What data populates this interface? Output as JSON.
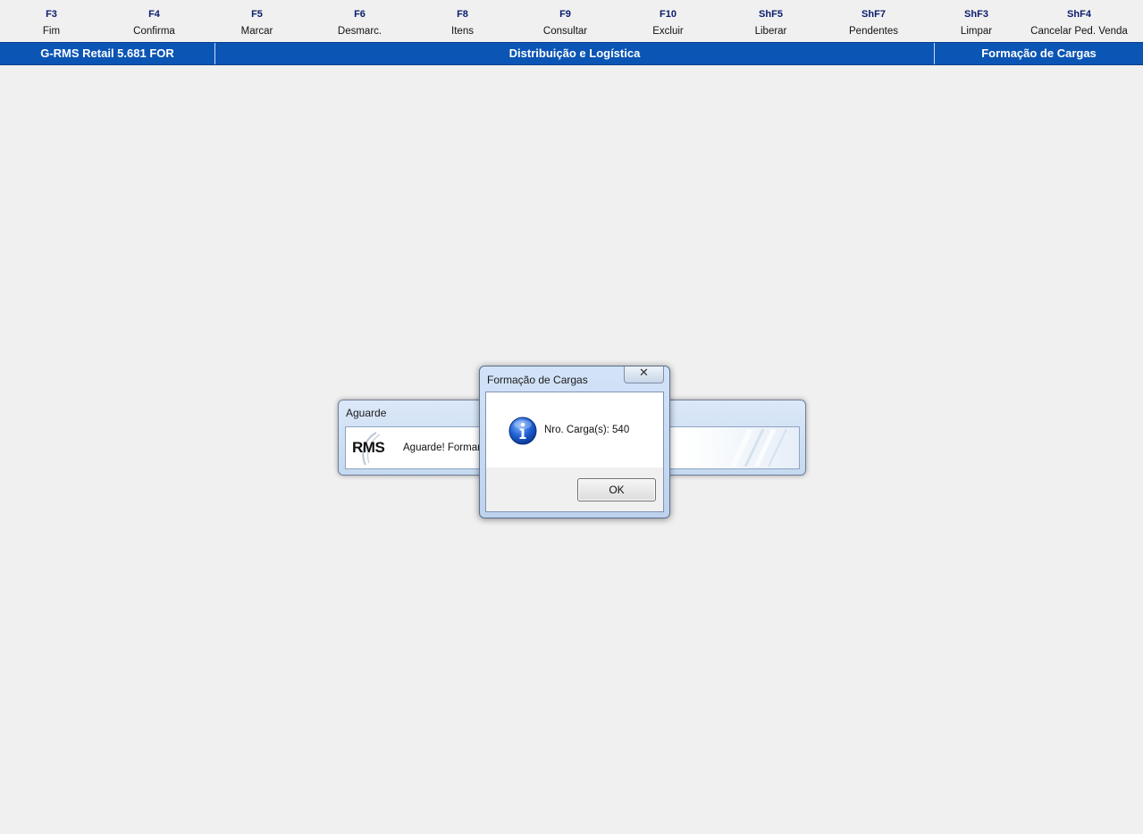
{
  "function_keys": [
    {
      "code": "F3",
      "label": "Fim"
    },
    {
      "code": "F4",
      "label": "Confirma"
    },
    {
      "code": "F5",
      "label": "Marcar"
    },
    {
      "code": "F6",
      "label": "Desmarc."
    },
    {
      "code": "F8",
      "label": "Itens"
    },
    {
      "code": "F9",
      "label": "Consultar"
    },
    {
      "code": "F10",
      "label": "Excluir"
    },
    {
      "code": "ShF5",
      "label": "Liberar"
    },
    {
      "code": "ShF7",
      "label": "Pendentes"
    },
    {
      "code": "ShF3",
      "label": "Limpar"
    },
    {
      "code": "ShF4",
      "label": "Cancelar Ped. Venda"
    }
  ],
  "status_bar": {
    "app_version": "G-RMS Retail 5.681 FOR",
    "module": "Distribuição e Logística",
    "screen": "Formação de Cargas",
    "color": "#0b55b5"
  },
  "wait_window": {
    "title": "Aguarde",
    "logo_text": "RMS",
    "message": "Aguarde! Formando"
  },
  "message_box": {
    "title": "Formação de Cargas",
    "close_glyph": "✕",
    "icon": "info-icon",
    "text": "Nro. Carga(s): 540",
    "ok_label": "OK"
  }
}
